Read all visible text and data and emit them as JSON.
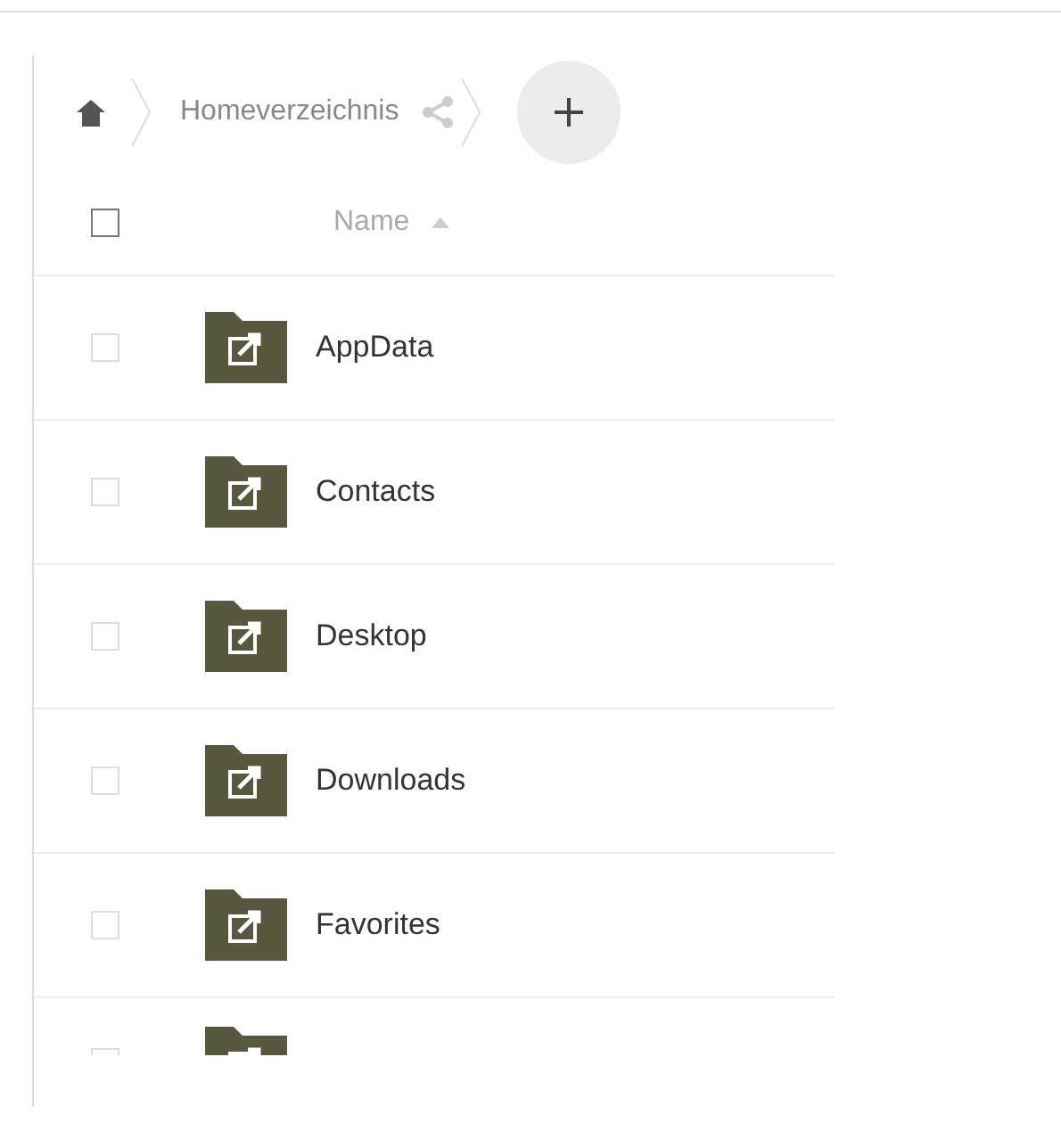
{
  "breadcrumb": {
    "folder": "Homeverzeichnis"
  },
  "header": {
    "select_all_checked": false,
    "column": "Name",
    "sort_ascending": true
  },
  "rows": [
    {
      "kind": "full",
      "name": "AppData",
      "checked": false
    },
    {
      "kind": "full",
      "name": "Contacts",
      "checked": false
    },
    {
      "kind": "full",
      "name": "Desktop",
      "checked": false
    },
    {
      "kind": "full",
      "name": "Downloads",
      "checked": false
    },
    {
      "kind": "full",
      "name": "Favorites",
      "checked": false
    },
    {
      "kind": "cut",
      "checked": false
    }
  ]
}
